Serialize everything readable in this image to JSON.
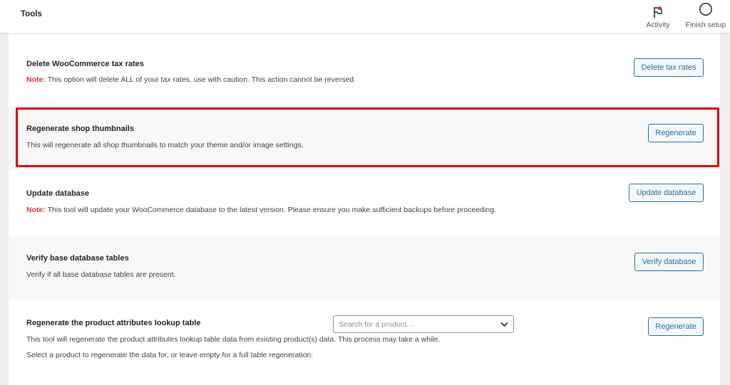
{
  "header": {
    "title": "Tools",
    "activity_label": "Activity",
    "finish_setup_label": "Finish setup"
  },
  "tools": [
    {
      "title": "Delete WooCommerce tax rates",
      "note_label": "Note:",
      "description": " This option will delete ALL of your tax rates, use with caution. This action cannot be reversed.",
      "button": "Delete tax rates"
    },
    {
      "title": "Regenerate shop thumbnails",
      "description": "This will regenerate all shop thumbnails to match your theme and/or image settings.",
      "button": "Regenerate"
    },
    {
      "title": "Update database",
      "note_label": "Note:",
      "description": " This tool will update your WooCommerce database to the latest version. Please ensure you make sufficient backups before proceeding.",
      "button": "Update database"
    },
    {
      "title": "Verify base database tables",
      "description": "Verify if all base database tables are present.",
      "button": "Verify database"
    },
    {
      "title": "Regenerate the product attributes lookup table",
      "description": "This tool will regenerate the product attributes lookup table data from existing product(s) data. This process may take a while.",
      "select_label": "Select a product to regenerate the data for, or leave empty for a full table regeneration:",
      "select_placeholder": "Search for a product...",
      "button": "Regenerate"
    }
  ],
  "colors": {
    "accent": "#2271b1",
    "note": "#d63638",
    "highlight_border": "#e00000"
  }
}
